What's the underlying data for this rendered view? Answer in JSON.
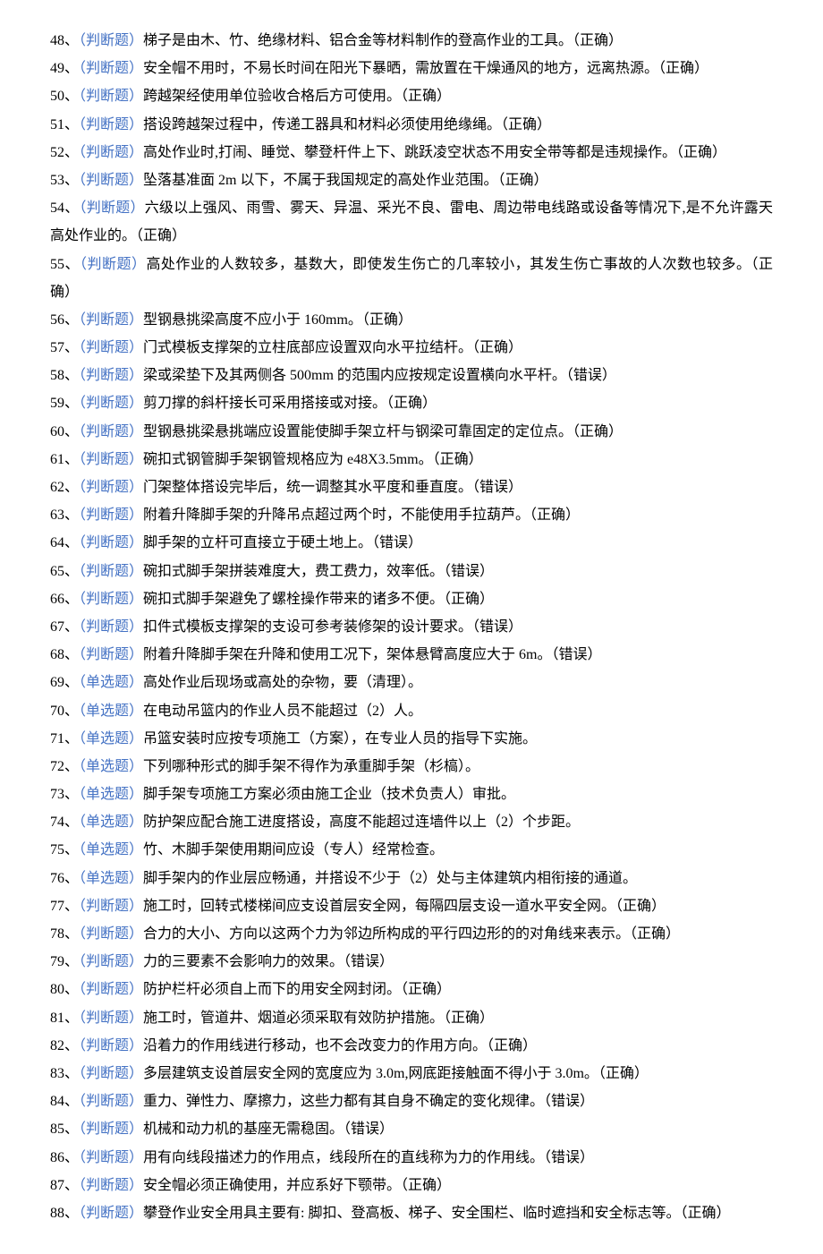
{
  "questions": [
    {
      "num": "48、",
      "tag": "（判断题）",
      "text": "梯子是由木、竹、绝缘材料、铝合金等材料制作的登高作业的工具。（正确）"
    },
    {
      "num": "49、",
      "tag": "（判断题）",
      "text": "安全帽不用时，不易长时间在阳光下暴晒，需放置在干燥通风的地方，远离热源。（正确）"
    },
    {
      "num": "50、",
      "tag": "（判断题）",
      "text": "跨越架经使用单位验收合格后方可使用。（正确）"
    },
    {
      "num": "51、",
      "tag": "（判断题）",
      "text": "搭设跨越架过程中，传递工器具和材料必须使用绝缘绳。（正确）"
    },
    {
      "num": "52、",
      "tag": "（判断题）",
      "text": "高处作业时,打闹、睡觉、攀登杆件上下、跳跃凌空状态不用安全带等都是违规操作。（正确）"
    },
    {
      "num": "53、",
      "tag": "（判断题）",
      "text": "坠落基准面 2m 以下，不属于我国规定的高处作业范围。（正确）"
    },
    {
      "num": "54、",
      "tag": "（判断题）",
      "text": "六级以上强风、雨雪、雾天、异温、采光不良、雷电、周边带电线路或设备等情况下,是不允许露天高处作业的。（正确）"
    },
    {
      "num": "55、",
      "tag": "（判断题）",
      "text": "高处作业的人数较多，基数大，即使发生伤亡的几率较小，其发生伤亡事故的人次数也较多。（正确）"
    },
    {
      "num": "56、",
      "tag": "（判断题）",
      "text": "型钢悬挑梁高度不应小于 160mm。（正确）"
    },
    {
      "num": "57、",
      "tag": "（判断题）",
      "text": "门式模板支撑架的立柱底部应设置双向水平拉结杆。（正确）"
    },
    {
      "num": "58、",
      "tag": "（判断题）",
      "text": "梁或梁垫下及其两侧各 500mm 的范围内应按规定设置横向水平杆。（错误）"
    },
    {
      "num": "59、",
      "tag": "（判断题）",
      "text": "剪刀撑的斜杆接长可采用搭接或对接。（正确）"
    },
    {
      "num": "60、",
      "tag": "（判断题）",
      "text": "型钢悬挑梁悬挑端应设置能使脚手架立杆与钢梁可靠固定的定位点。（正确）"
    },
    {
      "num": "61、",
      "tag": "（判断题）",
      "text": "碗扣式钢管脚手架钢管规格应为 e48X3.5mm。（正确）"
    },
    {
      "num": "62、",
      "tag": "（判断题）",
      "text": "门架整体搭设完毕后，统一调整其水平度和垂直度。（错误）"
    },
    {
      "num": "63、",
      "tag": "（判断题）",
      "text": "附着升降脚手架的升降吊点超过两个时，不能使用手拉葫芦。（正确）"
    },
    {
      "num": "64、",
      "tag": "（判断题）",
      "text": "脚手架的立杆可直接立于硬土地上。（错误）"
    },
    {
      "num": "65、",
      "tag": "（判断题）",
      "text": "碗扣式脚手架拼装难度大，费工费力，效率低。（错误）"
    },
    {
      "num": "66、",
      "tag": "（判断题）",
      "text": "碗扣式脚手架避免了螺栓操作带来的诸多不便。（正确）"
    },
    {
      "num": "67、",
      "tag": "（判断题）",
      "text": "扣件式模板支撑架的支设可参考装修架的设计要求。（错误）"
    },
    {
      "num": "68、",
      "tag": "（判断题）",
      "text": "附着升降脚手架在升降和使用工况下，架体悬臂高度应大于 6m。（错误）"
    },
    {
      "num": "69、",
      "tag": "（单选题）",
      "text": "高处作业后现场或高处的杂物，要（清理）。"
    },
    {
      "num": "70、",
      "tag": "（单选题）",
      "text": "在电动吊篮内的作业人员不能超过（2）人。"
    },
    {
      "num": "71、",
      "tag": "（单选题）",
      "text": "吊篮安装时应按专项施工（方案），在专业人员的指导下实施。"
    },
    {
      "num": "72、",
      "tag": "（单选题）",
      "text": "下列哪种形式的脚手架不得作为承重脚手架（杉槁）。"
    },
    {
      "num": "73、",
      "tag": "（单选题）",
      "text": "脚手架专项施工方案必须由施工企业（技术负责人）审批。"
    },
    {
      "num": "74、",
      "tag": "（单选题）",
      "text": "防护架应配合施工进度搭设，高度不能超过连墙件以上（2）个步距。"
    },
    {
      "num": "75、",
      "tag": "（单选题）",
      "text": "竹、木脚手架使用期间应设（专人）经常检查。"
    },
    {
      "num": "76、",
      "tag": "（单选题）",
      "text": "脚手架内的作业层应畅通，并搭设不少于（2）处与主体建筑内相衔接的通道。"
    },
    {
      "num": "77、",
      "tag": "（判断题）",
      "text": "施工时，回转式楼梯间应支设首层安全网，每隔四层支设一道水平安全网。（正确）"
    },
    {
      "num": "78、",
      "tag": "（判断题）",
      "text": "合力的大小、方向以这两个力为邻边所构成的平行四边形的的对角线来表示。（正确）"
    },
    {
      "num": "79、",
      "tag": "（判断题）",
      "text": "力的三要素不会影响力的效果。（错误）"
    },
    {
      "num": "80、",
      "tag": "（判断题）",
      "text": "防护栏杆必须自上而下的用安全网封闭。（正确）"
    },
    {
      "num": "81、",
      "tag": "（判断题）",
      "text": "施工时，管道井、烟道必须采取有效防护措施。（正确）"
    },
    {
      "num": "82、",
      "tag": "（判断题）",
      "text": "沿着力的作用线进行移动，也不会改变力的作用方向。（正确）"
    },
    {
      "num": "83、",
      "tag": "（判断题）",
      "text": "多层建筑支设首层安全网的宽度应为 3.0m,网底距接触面不得小于 3.0m。（正确）"
    },
    {
      "num": "84、",
      "tag": "（判断题）",
      "text": "重力、弹性力、摩擦力，这些力都有其自身不确定的变化规律。（错误）"
    },
    {
      "num": "85、",
      "tag": "（判断题）",
      "text": "机械和动力机的基座无需稳固。（错误）"
    },
    {
      "num": "86、",
      "tag": "（判断题）",
      "text": "用有向线段描述力的作用点，线段所在的直线称为力的作用线。（错误）"
    },
    {
      "num": "87、",
      "tag": "（判断题）",
      "text": "安全帽必须正确使用，并应系好下颚带。（正确）"
    },
    {
      "num": "88、",
      "tag": "（判断题）",
      "text": "攀登作业安全用具主要有: 脚扣、登高板、梯子、安全围栏、临时遮挡和安全标志等。（正确）"
    }
  ]
}
